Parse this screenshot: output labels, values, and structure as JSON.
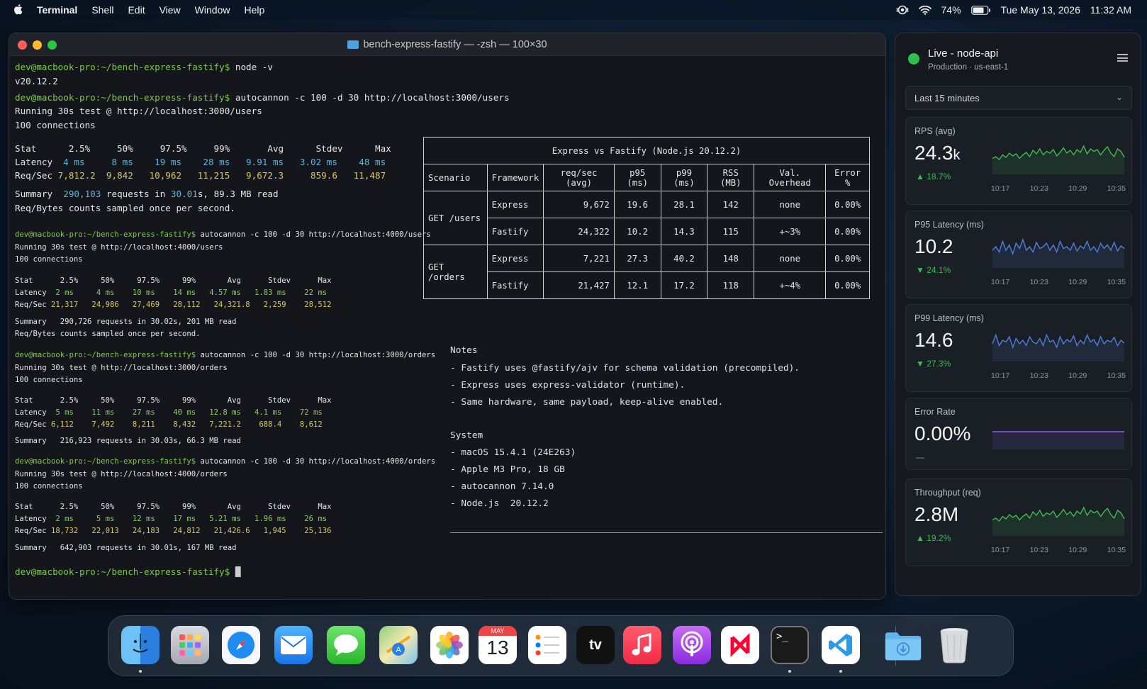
{
  "menubar": {
    "app": "Terminal",
    "menus": [
      "Shell",
      "Edit",
      "View",
      "Window",
      "Help"
    ],
    "battery": "74%",
    "date": "Tue May 13, 2026",
    "time": "11:32 AM"
  },
  "terminal": {
    "title": "bench-express-fastify — -zsh — 100×30",
    "prompt": "dev@macbook-pro:~/bench-express-fastify$",
    "cmd_node": " node -v",
    "node_version": "v20.12.2",
    "run1": {
      "cmd": " autocannon -c 100 -d 30 http://localhost:3000/users",
      "running": "Running 30s test @ http://localhost:3000/users",
      "connections": "100 connections",
      "header": "Stat      2.5%     50%     97.5%     99%       Avg      Stdev      Max",
      "latency_label": "Latency",
      "latency_vals": "  4 ms     8 ms    19 ms    28 ms   9.91 ms   3.02 ms    48 ms",
      "reqsec_label": "Req/Sec",
      "reqsec_vals": " 7,812.2  9,842   10,962   11,215   9,672.3     859.6   11,487",
      "summary_label": "Summary  ",
      "summary_req": "290,103",
      "summary_mid": " requests in ",
      "summary_time": "30.01",
      "summary_end": "s, 89.3 MB read",
      "sampled": "Req/Bytes counts sampled once per second."
    },
    "run2": {
      "cmd": " autocannon -c 100 -d 30 http://localhost:4000/users",
      "running": "Running 30s test @ http://localhost:4000/users",
      "connections": "100 connections",
      "header": "Stat      2.5%     50%     97.5%     99%       Avg      Stdev      Max",
      "latency_label": "Latency",
      "latency_vals": "  2 ms     4 ms    10 ms    14 ms   4.57 ms   1.83 ms    22 ms",
      "reqsec_label": "Req/Sec",
      "reqsec_vals": " 21,317   24,986   27,469   28,112   24,321.8   2,259    28,512",
      "summary": "Summary   290,726 requests in 30.02s, 201 MB read",
      "sampled": "Req/Bytes counts sampled once per second."
    },
    "run3": {
      "cmd": " autocannon -c 100 -d 30 http://localhost:3000/orders",
      "running": "Running 30s test @ http://localhost:3000/orders",
      "connections": "100 connections",
      "header": "Stat      2.5%     50%     97.5%     99%       Avg      Stdev      Max",
      "latency_label": "Latency",
      "latency_vals": "  5 ms    11 ms    27 ms    40 ms   12.8 ms   4.1 ms    72 ms",
      "reqsec_label": "Req/Sec",
      "reqsec_vals": " 6,112    7,492    8,211    8,432   7,221.2    688.4    8,612",
      "summary": "Summary   216,923 requests in 30.03s, 66.3 MB read"
    },
    "run4": {
      "cmd": " autocannon -c 100 -d 30 http://localhost:4000/orders",
      "running": "Running 30s test @ http://localhost:4000/orders",
      "connections": "100 connections",
      "header": "Stat      2.5%     50%     97.5%     99%       Avg      Stdev      Max",
      "latency_label": "Latency",
      "latency_vals": "  2 ms     5 ms    12 ms    17 ms   5.21 ms   1.96 ms    26 ms",
      "reqsec_label": "Req/Sec",
      "reqsec_vals": " 18,732   22,013   24,183   24,812   21,426.6   1,945    25,136",
      "summary": "Summary   642,903 requests in 30.01s, 167 MB read"
    },
    "cursor": "█"
  },
  "table": {
    "title": "Express vs Fastify (Node.js 20.12.2)",
    "headers": [
      "Scenario",
      "Framework",
      "req/sec (avg)",
      "p95 (ms)",
      "p99 (ms)",
      "RSS (MB)",
      "Val. Overhead",
      "Error %"
    ],
    "groups": [
      {
        "scenario": "GET /users",
        "rows": [
          [
            "Express",
            "9,672",
            "19.6",
            "28.1",
            "142",
            "none",
            "0.00%"
          ],
          [
            "Fastify",
            "24,322",
            "10.2",
            "14.3",
            "115",
            "+~3%",
            "0.00%"
          ]
        ]
      },
      {
        "scenario": "GET /orders",
        "rows": [
          [
            "Express",
            "7,221",
            "27.3",
            "40.2",
            "148",
            "none",
            "0.00%"
          ],
          [
            "Fastify",
            "21,427",
            "12.1",
            "17.2",
            "118",
            "+~4%",
            "0.00%"
          ]
        ]
      }
    ]
  },
  "notes": {
    "title": "Notes",
    "items": [
      "- Fastify uses @fastify/ajv for schema validation (precompiled).",
      "- Express uses express-validator (runtime).",
      "- Same hardware, same payload, keep-alive enabled."
    ],
    "system_title": "System",
    "system_items": [
      "- macOS 15.4.1 (24E263)",
      "- Apple M3 Pro, 18 GB",
      "- autocannon 7.14.0",
      "- Node.js  20.12.2"
    ]
  },
  "panel": {
    "title": "Live - node-api",
    "subtitle": "Production · us-east-1",
    "range": "Last 15 minutes",
    "ticks": [
      "10:17",
      "10:23",
      "10:29",
      "10:35"
    ],
    "cards": [
      {
        "label": "RPS (avg)",
        "value": "24.3",
        "unit": "k",
        "change": "▲ 18.7%",
        "color": "#3fb950",
        "series": [
          0.45,
          0.5,
          0.42,
          0.55,
          0.48,
          0.6,
          0.52,
          0.58,
          0.45,
          0.55,
          0.62,
          0.5,
          0.68,
          0.58,
          0.72,
          0.55,
          0.65,
          0.6,
          0.7,
          0.52,
          0.62,
          0.75,
          0.6,
          0.68,
          0.55,
          0.7,
          0.62,
          0.8,
          0.58,
          0.72,
          0.65,
          0.7,
          0.55,
          0.68,
          0.78,
          0.6,
          0.5,
          0.72,
          0.65,
          0.48
        ]
      },
      {
        "label": "P95 Latency (ms)",
        "value": "10.2",
        "unit": "",
        "change": "▼ 24.1%",
        "color": "#4f7fd9",
        "series": [
          0.5,
          0.6,
          0.45,
          0.75,
          0.5,
          0.65,
          0.4,
          0.7,
          0.55,
          0.8,
          0.5,
          0.6,
          0.45,
          0.72,
          0.55,
          0.6,
          0.7,
          0.5,
          0.65,
          0.45,
          0.75,
          0.55,
          0.6,
          0.5,
          0.7,
          0.48,
          0.62,
          0.55,
          0.75,
          0.5,
          0.6,
          0.45,
          0.7,
          0.55,
          0.65,
          0.5,
          0.72,
          0.48,
          0.62,
          0.55
        ]
      },
      {
        "label": "P99 Latency (ms)",
        "value": "14.6",
        "unit": "",
        "change": "▼ 27.3%",
        "color": "#4f7fd9",
        "series": [
          0.5,
          0.75,
          0.45,
          0.6,
          0.55,
          0.7,
          0.4,
          0.65,
          0.5,
          0.6,
          0.45,
          0.7,
          0.55,
          0.5,
          0.65,
          0.45,
          0.75,
          0.55,
          0.6,
          0.4,
          0.7,
          0.5,
          0.62,
          0.55,
          0.72,
          0.45,
          0.6,
          0.5,
          0.75,
          0.55,
          0.62,
          0.45,
          0.7,
          0.5,
          0.6,
          0.55,
          0.68,
          0.45,
          0.6,
          0.52
        ]
      },
      {
        "label": "Error Rate",
        "value": "0.00%",
        "unit": "",
        "change": "—",
        "color": "#8b5cf6",
        "series": [
          0.5,
          0.5,
          0.5,
          0.5,
          0.5,
          0.5,
          0.5,
          0.5,
          0.5,
          0.5
        ]
      },
      {
        "label": "Throughput (req)",
        "value": "2.8M",
        "unit": "",
        "change": "▲ 19.2%",
        "color": "#3fb950",
        "series": [
          0.45,
          0.5,
          0.42,
          0.55,
          0.48,
          0.6,
          0.52,
          0.58,
          0.45,
          0.55,
          0.62,
          0.5,
          0.68,
          0.58,
          0.72,
          0.55,
          0.65,
          0.6,
          0.7,
          0.52,
          0.62,
          0.75,
          0.6,
          0.68,
          0.55,
          0.7,
          0.62,
          0.8,
          0.58,
          0.72,
          0.65,
          0.7,
          0.55,
          0.68,
          0.78,
          0.6,
          0.5,
          0.72,
          0.65,
          0.48
        ]
      }
    ]
  },
  "dock": {
    "calendar_month": "MAY",
    "calendar_day": "13",
    "tv_label": "tv",
    "terminal_glyph": ">_"
  }
}
